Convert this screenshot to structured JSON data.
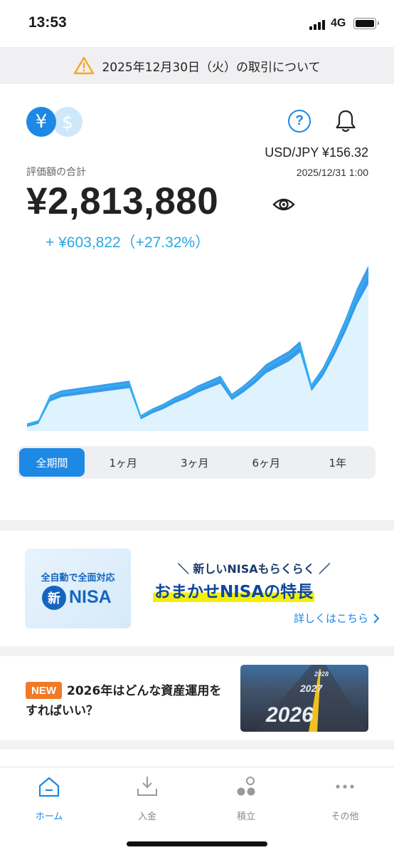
{
  "status_bar": {
    "time": "13:53",
    "network": "4G"
  },
  "notice": {
    "text": "2025年12月30日（火）の取引について",
    "icon": "warning-icon"
  },
  "header": {
    "currency_yen": "¥",
    "currency_usd": "$",
    "help": "?",
    "fx_rate": "USD/JPY  ¥156.32",
    "fx_time": "2025/12/31 1:00"
  },
  "summary": {
    "label": "評価額の合計",
    "total": "¥2,813,880",
    "gain": "+ ¥603,822（+27.32%）"
  },
  "chart_data": {
    "type": "area",
    "series": [
      {
        "values": [
          0.04,
          0.06,
          0.21,
          0.24,
          0.25,
          0.26,
          0.27,
          0.28,
          0.29,
          0.3,
          0.09,
          0.13,
          0.16,
          0.2,
          0.23,
          0.27,
          0.3,
          0.33,
          0.22,
          0.27,
          0.33,
          0.4,
          0.44,
          0.48,
          0.54,
          0.28,
          0.38,
          0.52,
          0.68,
          0.86,
          1.0
        ]
      }
    ],
    "colors": {
      "line": "#29b6f6",
      "band": "#1e88e5",
      "fill": "#dff3fe"
    }
  },
  "periods": {
    "items": [
      "全期間",
      "1ヶ月",
      "3ヶ月",
      "6ヶ月",
      "1年"
    ],
    "active_index": 0
  },
  "nisa_promo": {
    "banner_top": "全自動で全面対応",
    "banner_mark": "新",
    "banner_word": "NISA",
    "subtitle": "＼ 新しいNISAもらくらく ／",
    "title": "おまかせNISAの特長",
    "more_link": "詳しくはこちら"
  },
  "news": {
    "badge": "NEW",
    "title": "2026年はどんな資産運用をすればいい？",
    "image_text_main": "2026",
    "image_text_back": "2027",
    "image_text_far": "2028"
  },
  "tabbar": {
    "items": [
      {
        "label": "ホーム",
        "icon": "home-icon"
      },
      {
        "label": "入金",
        "icon": "deposit-icon"
      },
      {
        "label": "積立",
        "icon": "savings-icon"
      },
      {
        "label": "その他",
        "icon": "more-icon"
      }
    ],
    "active_index": 0
  },
  "colors": {
    "accent": "#1e88e5",
    "gain": "#29a8e0",
    "badge": "#f07a28",
    "highlight": "#f4f000"
  }
}
